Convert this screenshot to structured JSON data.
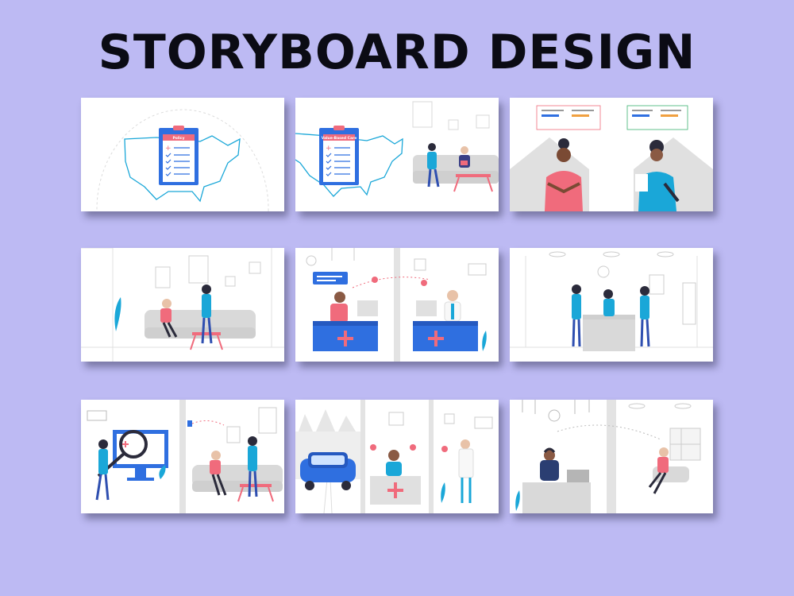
{
  "page": {
    "title": "STORYBOARD DESIGN"
  },
  "panels": [
    {
      "id": 1,
      "clipboard_label": "Policy"
    },
    {
      "id": 2,
      "clipboard_label": "Value-Based Care"
    },
    {
      "id": 3
    },
    {
      "id": 4
    },
    {
      "id": 5
    },
    {
      "id": 6
    },
    {
      "id": 7
    },
    {
      "id": 8
    },
    {
      "id": 9
    }
  ],
  "colors": {
    "background": "#bdbaf3",
    "accent_blue": "#2f6fe0",
    "accent_pink": "#f06b7c",
    "scrub_teal": "#1aa7d8",
    "outline_gray": "#d9d9d9"
  }
}
